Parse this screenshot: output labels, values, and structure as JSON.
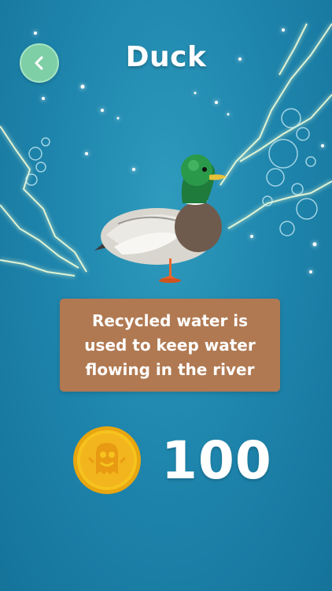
{
  "header": {
    "title": "Duck",
    "back_icon": "chevron-left-icon"
  },
  "fact": {
    "text": "Recycled water is used to keep water flowing in the river"
  },
  "reward": {
    "coin_icon": "gold-coin-icon",
    "amount": "100"
  },
  "colors": {
    "background": "#1f86ad",
    "back_button": "#7fcfa6",
    "fact_card": "#b07952",
    "coin": "#f2b51d"
  }
}
